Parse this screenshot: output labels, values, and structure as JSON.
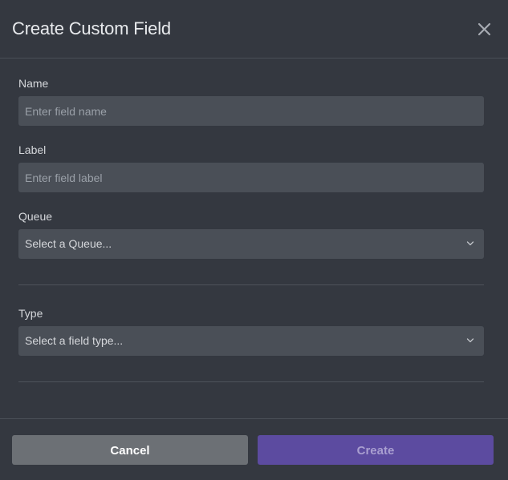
{
  "dialog": {
    "title": "Create Custom Field",
    "close_icon": "close-icon"
  },
  "fields": {
    "name": {
      "label": "Name",
      "placeholder": "Enter field name",
      "value": ""
    },
    "label": {
      "label": "Label",
      "placeholder": "Enter field label",
      "value": ""
    },
    "queue": {
      "label": "Queue",
      "selected": "Select a Queue...",
      "icon": "chevron-down-icon"
    },
    "type": {
      "label": "Type",
      "selected": "Select a field type...",
      "icon": "chevron-down-icon"
    }
  },
  "footer": {
    "cancel_label": "Cancel",
    "create_label": "Create"
  },
  "colors": {
    "background": "#343840",
    "input_background": "#4a4f57",
    "cancel_button": "#6c7075",
    "create_button": "#5c4ba0",
    "create_text_disabled": "#a99fd0"
  }
}
